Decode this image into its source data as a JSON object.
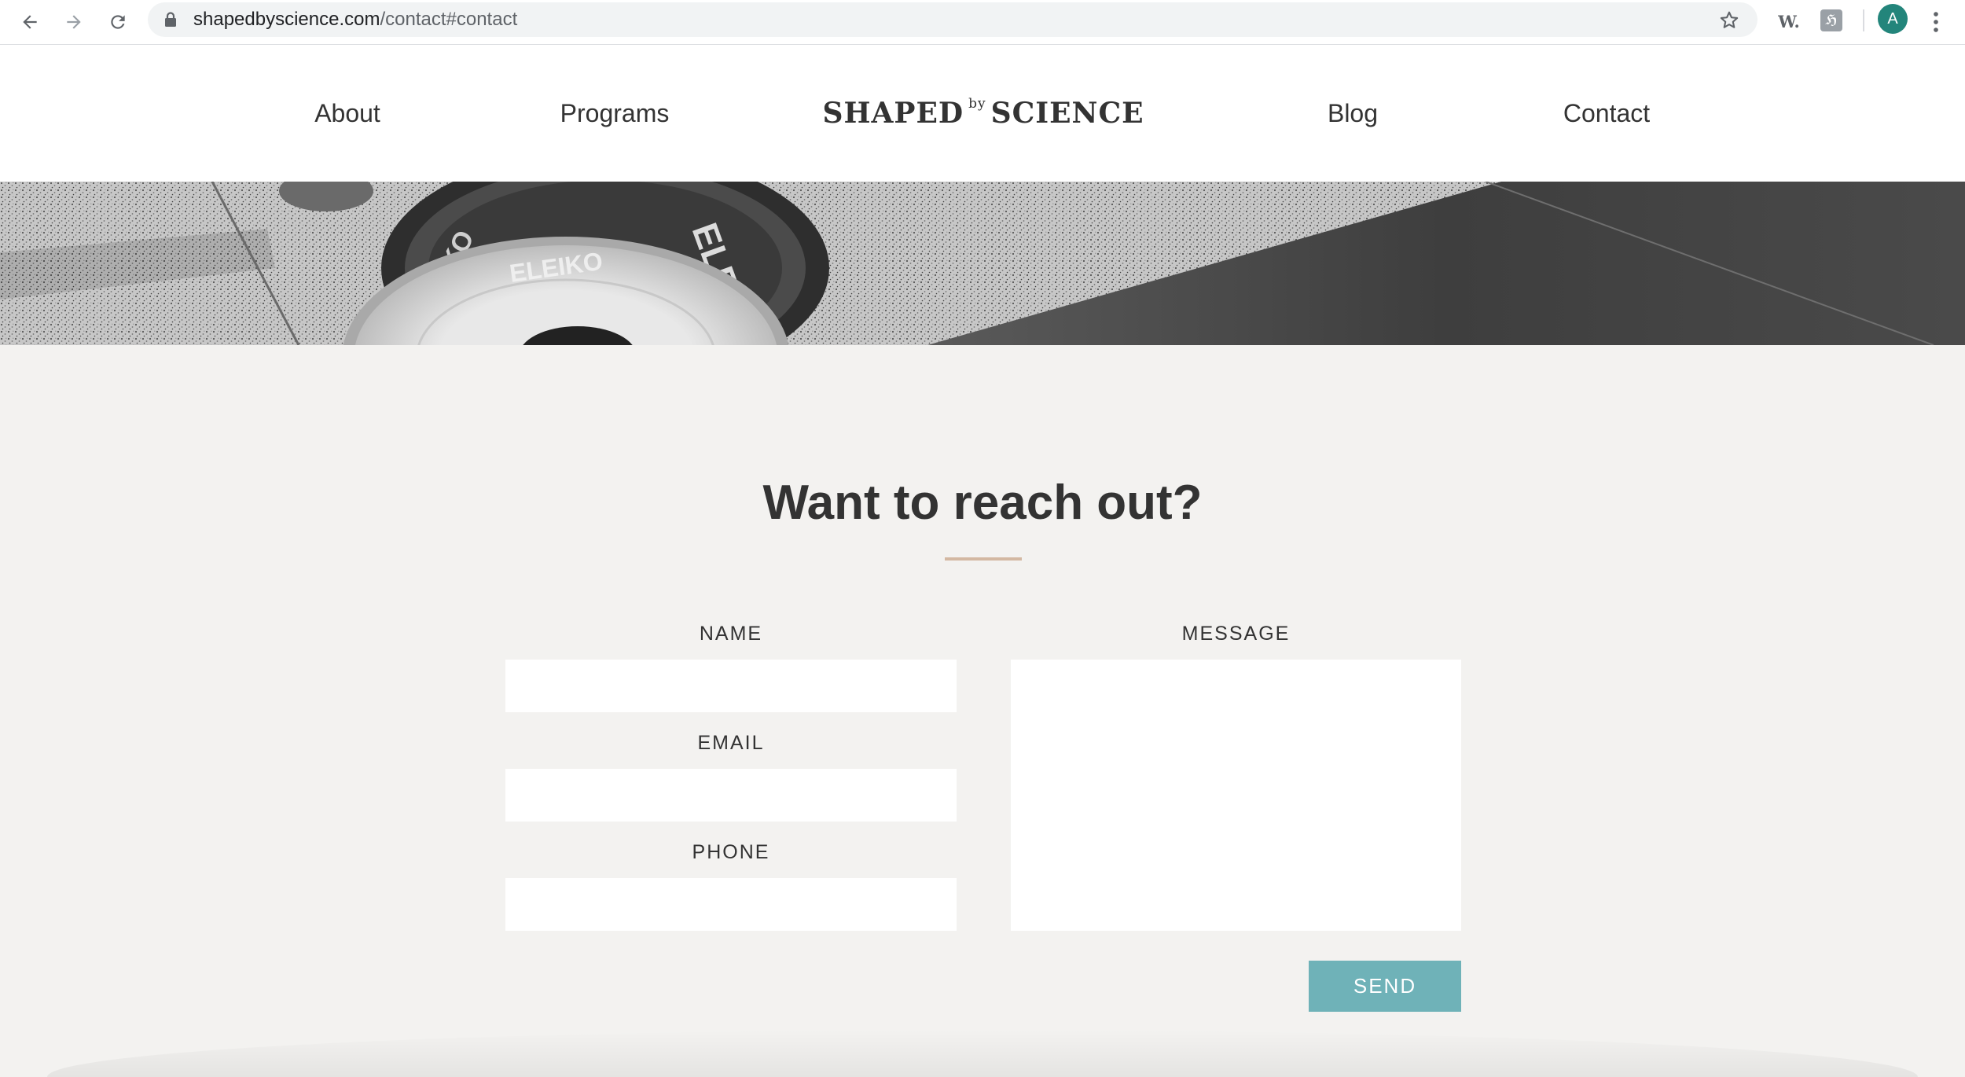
{
  "browser": {
    "url_domain": "shapedbyscience.com",
    "url_path": "/contact#contact",
    "extension_w_label": "W.",
    "extension_h_label": "ℌ",
    "profile_initial": "A",
    "profile_color": "#23857b",
    "icons": [
      "back-arrow-icon",
      "forward-arrow-icon",
      "reload-icon",
      "lock-icon",
      "bookmark-star-icon",
      "kebab-menu-icon"
    ]
  },
  "site": {
    "nav": {
      "about": "About",
      "programs": "Programs",
      "blog": "Blog",
      "contact": "Contact"
    },
    "logo": {
      "left": "SHAPED",
      "by": "by",
      "right": "SCIENCE"
    }
  },
  "contact": {
    "title": "Want to reach out?",
    "accent_color": "#d3b8a2",
    "fields": {
      "name": {
        "label": "NAME",
        "value": ""
      },
      "email": {
        "label": "EMAIL",
        "value": ""
      },
      "phone": {
        "label": "PHONE",
        "value": ""
      },
      "message": {
        "label": "MESSAGE",
        "value": ""
      }
    },
    "send_label": "SEND",
    "send_color": "#6fb2b8"
  }
}
